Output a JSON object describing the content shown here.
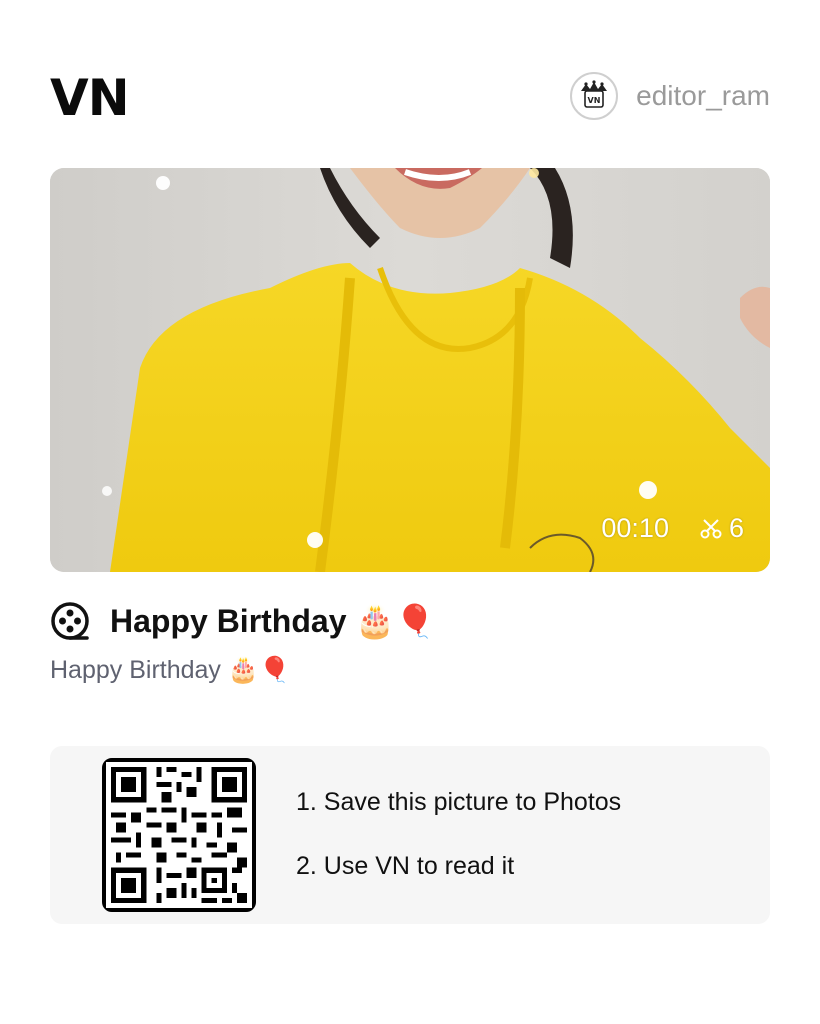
{
  "header": {
    "logo": "VN",
    "username": "editor_ram",
    "avatar_icon": "vn-crown-avatar-icon"
  },
  "video": {
    "duration": "00:10",
    "clip_count": "6",
    "cut_icon": "scissors-icon",
    "thumbnail_description_colors": {
      "hoodie": "#f4d21a",
      "background": "#d9d7d3"
    }
  },
  "template": {
    "icon": "film-reel-icon",
    "title": "Happy Birthday 🎂🎈",
    "description": "Happy Birthday 🎂🎈"
  },
  "qr": {
    "icon": "qr-code-icon",
    "step1": "1. Save this picture to Photos",
    "step2": "2. Use VN to read it"
  }
}
